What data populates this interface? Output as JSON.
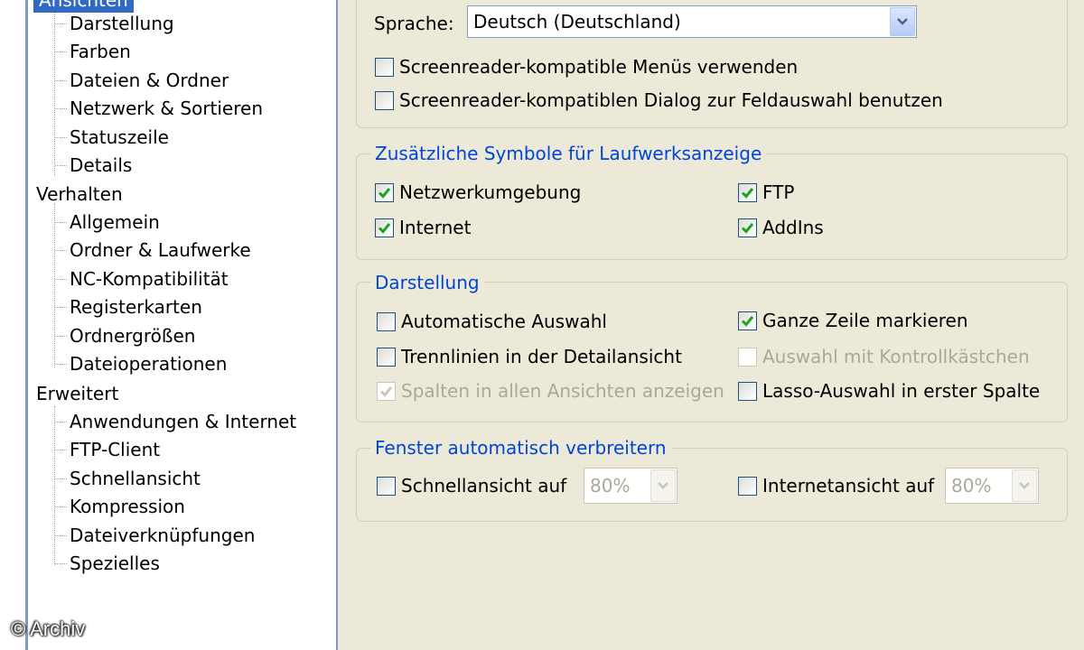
{
  "tree": {
    "selected": "Ansichten",
    "groups": [
      {
        "label": "Verhalten"
      },
      {
        "label": "Erweitert"
      }
    ],
    "ansichten_items": [
      "Darstellung",
      "Farben",
      "Dateien & Ordner",
      "Netzwerk & Sortieren",
      "Statuszeile",
      "Details"
    ],
    "verhalten_items": [
      "Allgemein",
      "Ordner & Laufwerke",
      "NC-Kompatibilität",
      "Registerkarten",
      "Ordnergrößen",
      "Dateioperationen"
    ],
    "erweitert_items": [
      "Anwendungen & Internet",
      "FTP-Client",
      "Schnellansicht",
      "Kompression",
      "Dateiverknüpfungen",
      "Spezielles"
    ]
  },
  "watermark": "© Archiv",
  "language": {
    "label": "Sprache:",
    "value": "Deutsch (Deutschland)",
    "options": [
      {
        "label": "Screenreader-kompatible Menüs verwenden",
        "checked": false
      },
      {
        "label": "Screenreader-kompatiblen Dialog zur Feldauswahl benutzen",
        "checked": false
      }
    ]
  },
  "drive_symbols": {
    "title": "Zusätzliche Symbole für Laufwerksanzeige",
    "items": [
      {
        "label": "Netzwerkumgebung",
        "checked": true
      },
      {
        "label": "FTP",
        "checked": true
      },
      {
        "label": "Internet",
        "checked": true
      },
      {
        "label": "AddIns",
        "checked": true
      }
    ]
  },
  "display": {
    "title": "Darstellung",
    "items": [
      {
        "label": "Automatische Auswahl",
        "checked": false,
        "disabled": false
      },
      {
        "label": "Ganze Zeile markieren",
        "checked": true,
        "disabled": false
      },
      {
        "label": "Trennlinien in der Detailansicht",
        "checked": false,
        "disabled": false
      },
      {
        "label": "Auswahl mit Kontrollkästchen",
        "checked": false,
        "disabled": true
      },
      {
        "label": "Spalten in allen Ansichten anzeigen",
        "checked": true,
        "disabled": true
      },
      {
        "label": "Lasso-Auswahl in erster Spalte",
        "checked": false,
        "disabled": false
      }
    ]
  },
  "window_expand": {
    "title": "Fenster automatisch verbreitern",
    "quickview": {
      "label": "Schnellansicht auf",
      "checked": false,
      "value": "80%"
    },
    "webview": {
      "label": "Internetansicht auf",
      "checked": false,
      "value": "80%"
    }
  },
  "colors": {
    "selection": "#316ac5",
    "group_title": "#0046d5",
    "check_green": "#21a121",
    "check_disabled": "#cac8bb"
  }
}
